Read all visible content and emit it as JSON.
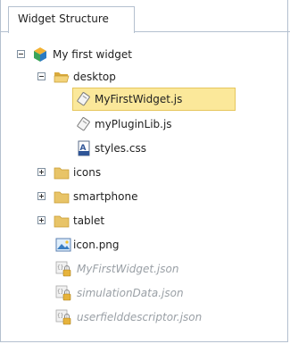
{
  "tab": {
    "title": "Widget Structure"
  },
  "tree": {
    "root": {
      "label": "My first widget"
    },
    "desktop": {
      "label": "desktop",
      "files": [
        {
          "label": "MyFirstWidget.js"
        },
        {
          "label": "myPluginLib.js"
        },
        {
          "label": "styles.css"
        }
      ]
    },
    "folders": [
      {
        "label": "icons"
      },
      {
        "label": "smartphone"
      },
      {
        "label": "tablet"
      }
    ],
    "root_files": [
      {
        "label": "icon.png"
      },
      {
        "label": "MyFirstWidget.json"
      },
      {
        "label": "simulationData.json"
      },
      {
        "label": "userfielddescriptor.json"
      }
    ]
  },
  "colors": {
    "selection_fill": "#fbe89a",
    "selection_border": "#e6c65c",
    "folder": "#e8c468",
    "dim_text": "#9aa0a6"
  }
}
